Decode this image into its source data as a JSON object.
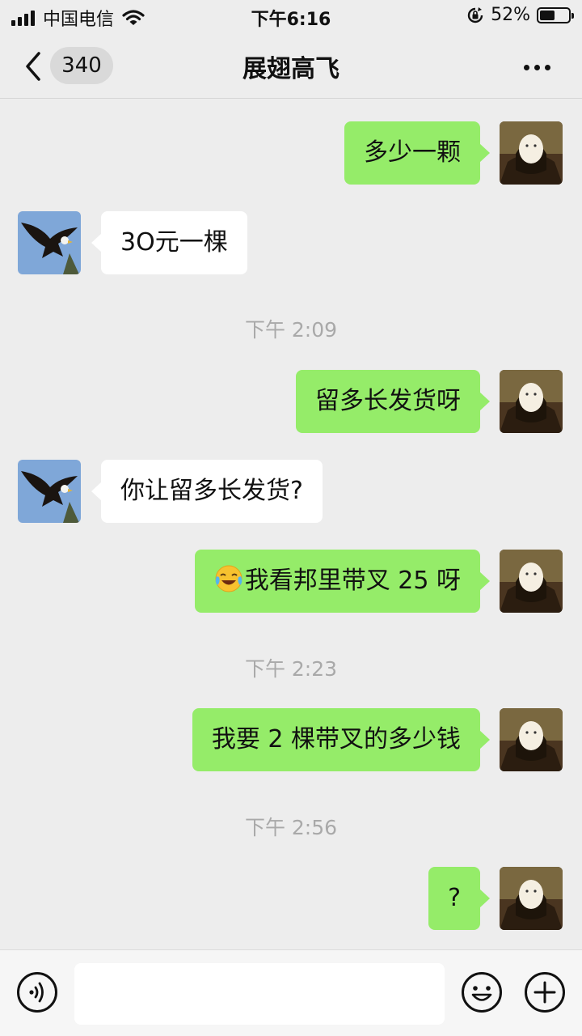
{
  "status": {
    "carrier": "中国电信",
    "time": "下午6:16",
    "battery": "52%",
    "battery_level": 0.52
  },
  "nav": {
    "unread_count": "340",
    "title": "展翅高飞"
  },
  "messages": [
    {
      "text": "多少一颗"
    },
    {
      "text": "3O元一棵"
    },
    {
      "time": "下午 2:09"
    },
    {
      "text": "留多长发货呀"
    },
    {
      "text": "你让留多长发货?"
    },
    {
      "text": "我看邦里带叉 25 呀",
      "emoji": "face-with-tears-of-joy"
    },
    {
      "time": "下午 2:23"
    },
    {
      "text": "我要 2 棵带叉的多少钱"
    },
    {
      "time": "下午 2:56"
    },
    {
      "text": "?"
    }
  ],
  "colors": {
    "background": "#ededed",
    "outgoing_bubble": "#95ec69",
    "incoming_bubble": "#ffffff",
    "timestamp": "#a9a9a9"
  },
  "icons": {
    "back": "chevron-left-icon",
    "more": "more-dots-icon",
    "voice": "voice-icon",
    "emoji": "smiley-icon",
    "plus": "plus-icon"
  }
}
